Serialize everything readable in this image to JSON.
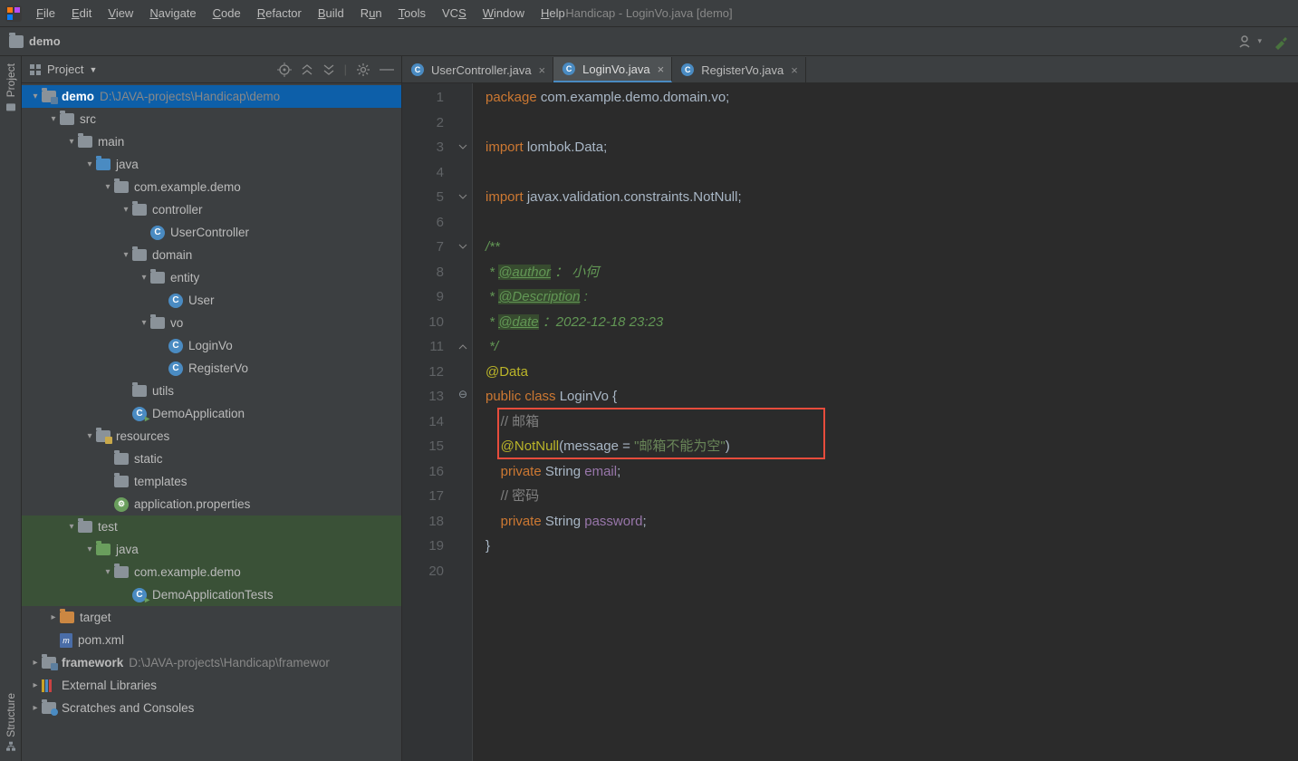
{
  "window_title": "Handicap - LoginVo.java [demo]",
  "menubar": [
    "File",
    "Edit",
    "View",
    "Navigate",
    "Code",
    "Refactor",
    "Build",
    "Run",
    "Tools",
    "VCS",
    "Window",
    "Help"
  ],
  "breadcrumb": {
    "project": "demo"
  },
  "panel": {
    "title": "Project",
    "tree": {
      "root": {
        "name": "demo",
        "path": "D:\\JAVA-projects\\Handicap\\demo"
      },
      "src": "src",
      "main": "main",
      "java": "java",
      "pkg": "com.example.demo",
      "controller": "controller",
      "userController": "UserController",
      "domain": "domain",
      "entity": "entity",
      "user": "User",
      "vo": "vo",
      "loginVo": "LoginVo",
      "registerVo": "RegisterVo",
      "utils": "utils",
      "demoApplication": "DemoApplication",
      "resources": "resources",
      "static": "static",
      "templates": "templates",
      "appProps": "application.properties",
      "test": "test",
      "testJava": "java",
      "testPkg": "com.example.demo",
      "demoAppTests": "DemoApplicationTests",
      "target": "target",
      "pom": "pom.xml",
      "framework": {
        "name": "framework",
        "path": "D:\\JAVA-projects\\Handicap\\framewor"
      },
      "extLibs": "External Libraries",
      "scratches": "Scratches and Consoles"
    }
  },
  "tabs": [
    {
      "label": "UserController.java",
      "active": false
    },
    {
      "label": "LoginVo.java",
      "active": true
    },
    {
      "label": "RegisterVo.java",
      "active": false
    }
  ],
  "code": {
    "l1_a": "package ",
    "l1_b": "com.example.demo.domain.vo",
    "l3_a": "import ",
    "l3_b": "lombok.Data",
    "l5_a": "import ",
    "l5_b": "javax.validation.constraints.NotNull",
    "l7": "/**",
    "l8_a": " * ",
    "l8_b": "@author",
    "l8_c": " ：",
    "l8_d": " 小何",
    "l9_a": " * ",
    "l9_b": "@Description",
    "l9_c": " :",
    "l10_a": " * ",
    "l10_b": "@date",
    "l10_c": " ：2022-12-18 23:23",
    "l11": " */",
    "l12": "@Data",
    "l13_a": "public class ",
    "l13_b": "LoginVo ",
    "l13_c": "{",
    "l14_a": "    ",
    "l14_b": "// 邮箱",
    "l15_a": "    ",
    "l15_b": "@NotNull",
    "l15_c": "(message = ",
    "l15_d": "\"邮箱不能为空\"",
    "l15_e": ")",
    "l16_a": "    ",
    "l16_b": "private ",
    "l16_c": "String ",
    "l16_d": "email",
    "l17_a": "    ",
    "l17_b": "// 密码",
    "l18_a": "    ",
    "l18_b": "private ",
    "l18_c": "String ",
    "l18_d": "password",
    "l19": "}"
  },
  "line_numbers": [
    "1",
    "2",
    "3",
    "4",
    "5",
    "6",
    "7",
    "8",
    "9",
    "10",
    "11",
    "12",
    "13",
    "14",
    "15",
    "16",
    "17",
    "18",
    "19",
    "20"
  ],
  "sidebar_labels": {
    "project": "Project",
    "structure": "Structure"
  }
}
